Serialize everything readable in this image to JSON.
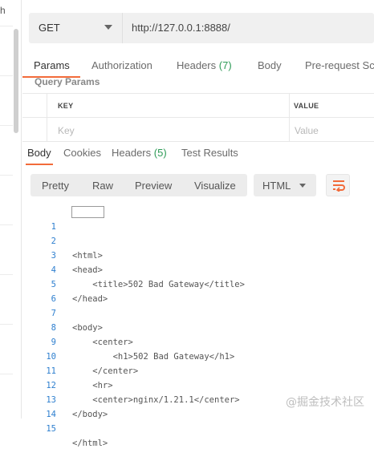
{
  "sidebar": {
    "top_text": "h"
  },
  "request": {
    "method": "GET",
    "url": "http://127.0.0.1:8888/"
  },
  "request_tabs": [
    {
      "label": "Params",
      "count": "",
      "active": true
    },
    {
      "label": "Authorization",
      "count": "",
      "active": false
    },
    {
      "label": "Headers",
      "count": "(7)",
      "active": false
    },
    {
      "label": "Body",
      "count": "",
      "active": false
    },
    {
      "label": "Pre-request Scr",
      "count": "",
      "active": false
    }
  ],
  "query_params": {
    "title": "Query Params",
    "columns": {
      "key": "KEY",
      "value": "VALUE"
    },
    "placeholders": {
      "key": "Key",
      "value": "Value"
    }
  },
  "response_tabs": [
    {
      "label": "Body",
      "count": "",
      "active": true
    },
    {
      "label": "Cookies",
      "count": "",
      "active": false
    },
    {
      "label": "Headers",
      "count": "(5)",
      "active": false
    },
    {
      "label": "Test Results",
      "count": "",
      "active": false
    }
  ],
  "view_modes": [
    "Pretty",
    "Raw",
    "Preview",
    "Visualize"
  ],
  "format": {
    "selected": "HTML"
  },
  "icons": {
    "method_dropdown": "chevron-down-icon",
    "format_dropdown": "chevron-down-icon",
    "wrap": "wrap-lines-icon"
  },
  "colors": {
    "accent": "#f26b3a",
    "count_green": "#2e9b57",
    "line_number": "#2e7fcf"
  },
  "code": {
    "lines": [
      {
        "num": "1",
        "text": "<html>"
      },
      {
        "num": "2",
        "text": ""
      },
      {
        "num": "3",
        "text": "<head>"
      },
      {
        "num": "4",
        "text": "    <title>502 Bad Gateway</title>"
      },
      {
        "num": "5",
        "text": "</head>"
      },
      {
        "num": "6",
        "text": ""
      },
      {
        "num": "7",
        "text": "<body>"
      },
      {
        "num": "8",
        "text": "    <center>"
      },
      {
        "num": "9",
        "text": "        <h1>502 Bad Gateway</h1>"
      },
      {
        "num": "10",
        "text": "    </center>"
      },
      {
        "num": "11",
        "text": "    <hr>"
      },
      {
        "num": "12",
        "text": "    <center>nginx/1.21.1</center>"
      },
      {
        "num": "13",
        "text": "</body>"
      },
      {
        "num": "14",
        "text": ""
      },
      {
        "num": "15",
        "text": "</html>"
      }
    ]
  },
  "watermark": "@掘金技术社区"
}
